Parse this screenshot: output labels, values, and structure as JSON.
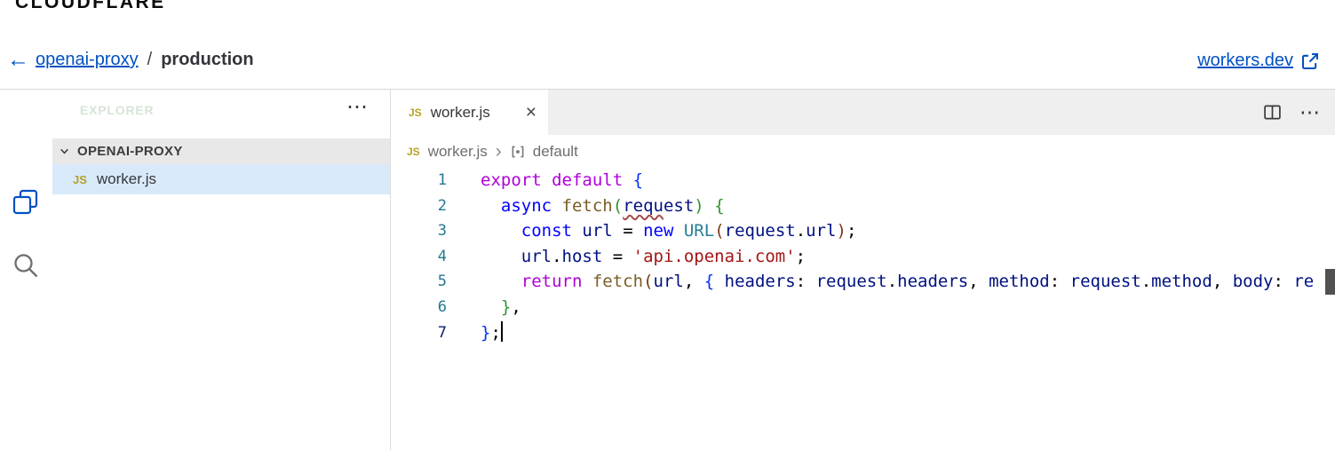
{
  "logo": "CLOUDFLARE",
  "topnav": {
    "back_arrow": "←",
    "project": "openai-proxy",
    "separator": "/",
    "environment": "production",
    "external_link": "workers.dev"
  },
  "explorer": {
    "title": "EXPLORER",
    "more": "⋯",
    "section_label": "OPENAI-PROXY",
    "file": {
      "badge": "JS",
      "name": "worker.js"
    }
  },
  "editor": {
    "tab": {
      "badge": "JS",
      "label": "worker.js",
      "close": "×"
    },
    "tab_actions": {
      "more": "⋯"
    },
    "breadcrumb": {
      "badge": "JS",
      "file": "worker.js",
      "separator": "›",
      "symbol": "default"
    },
    "colors": {
      "kw": "#af00db",
      "st": "#0000ff",
      "fn": "#795e26",
      "cls": "#267f99",
      "var": "#001080",
      "str": "#a31515",
      "pl": "#000000",
      "b1": "#0431fa",
      "b2": "#319331",
      "b3": "#7b3814"
    },
    "code": {
      "lines": [
        {
          "num": "1",
          "tokens": [
            [
              "export",
              "kw"
            ],
            [
              " ",
              "pl"
            ],
            [
              "default",
              "kw"
            ],
            [
              " ",
              "pl"
            ],
            [
              "{",
              "b1"
            ]
          ]
        },
        {
          "num": "2",
          "tokens": [
            [
              "  ",
              "pl"
            ],
            [
              "async",
              "st"
            ],
            [
              " ",
              "pl"
            ],
            [
              "fetch",
              "fn"
            ],
            [
              "(",
              "b2"
            ],
            [
              "requ",
              "var",
              true
            ],
            [
              "est",
              "var"
            ],
            [
              ")",
              "b2"
            ],
            [
              " ",
              "pl"
            ],
            [
              "{",
              "b2"
            ]
          ]
        },
        {
          "num": "3",
          "tokens": [
            [
              "    ",
              "pl"
            ],
            [
              "const",
              "st"
            ],
            [
              " ",
              "pl"
            ],
            [
              "url",
              "var"
            ],
            [
              " = ",
              "pl"
            ],
            [
              "new",
              "st"
            ],
            [
              " ",
              "pl"
            ],
            [
              "URL",
              "cls"
            ],
            [
              "(",
              "b3"
            ],
            [
              "request",
              "var"
            ],
            [
              ".",
              "pl"
            ],
            [
              "url",
              "var"
            ],
            [
              ")",
              "b3"
            ],
            [
              ";",
              "pl"
            ]
          ]
        },
        {
          "num": "4",
          "tokens": [
            [
              "    ",
              "pl"
            ],
            [
              "url",
              "var"
            ],
            [
              ".",
              "pl"
            ],
            [
              "host",
              "var"
            ],
            [
              " = ",
              "pl"
            ],
            [
              "'api.openai.com'",
              "str"
            ],
            [
              ";",
              "pl"
            ]
          ]
        },
        {
          "num": "5",
          "tokens": [
            [
              "    ",
              "pl"
            ],
            [
              "return",
              "kw"
            ],
            [
              " ",
              "pl"
            ],
            [
              "fetch",
              "fn"
            ],
            [
              "(",
              "b3"
            ],
            [
              "url",
              "var"
            ],
            [
              ", ",
              "pl"
            ],
            [
              "{",
              "b1"
            ],
            [
              " ",
              "pl"
            ],
            [
              "headers",
              "var"
            ],
            [
              ": ",
              "pl"
            ],
            [
              "request",
              "var"
            ],
            [
              ".",
              "pl"
            ],
            [
              "headers",
              "var"
            ],
            [
              ", ",
              "pl"
            ],
            [
              "method",
              "var"
            ],
            [
              ": ",
              "pl"
            ],
            [
              "request",
              "var"
            ],
            [
              ".",
              "pl"
            ],
            [
              "method",
              "var"
            ],
            [
              ", ",
              "pl"
            ],
            [
              "body",
              "var"
            ],
            [
              ": ",
              "pl"
            ],
            [
              "re",
              "var"
            ]
          ]
        },
        {
          "num": "6",
          "tokens": [
            [
              "  ",
              "pl"
            ],
            [
              "}",
              "b2"
            ],
            [
              ",",
              "pl"
            ]
          ]
        },
        {
          "num": "7",
          "active": true,
          "cursor": true,
          "tokens": [
            [
              "}",
              "b1"
            ],
            [
              ";",
              "pl"
            ]
          ]
        }
      ]
    }
  }
}
